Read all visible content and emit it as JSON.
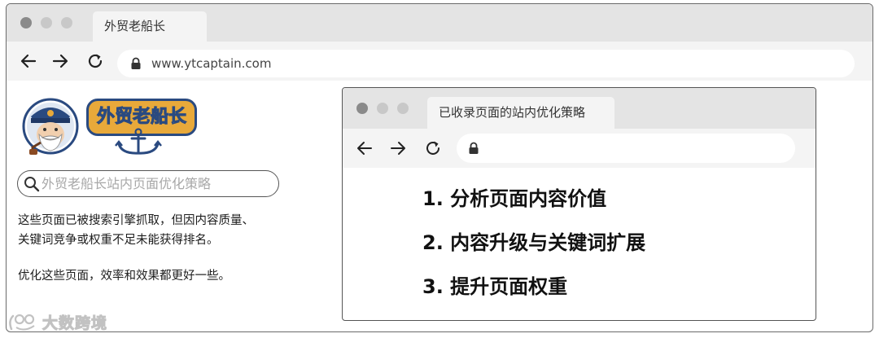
{
  "browser": {
    "tab_title": "外贸老船长",
    "url": "www.ytcaptain.com"
  },
  "logo": {
    "text": "外贸老船长"
  },
  "search": {
    "placeholder": "外贸老船长站内页面优化策略"
  },
  "description": {
    "line1": "这些页面已被搜索引擎抓取，但因内容质量、",
    "line2": "关键词竞争或权重不足未能获得排名。",
    "line3": "优化这些页面，效率和效果都更好一些。"
  },
  "inner_browser": {
    "tab_title": "已收录页面的站内优化策略",
    "items": [
      "1. 分析页面内容价值",
      "2. 内容升级与关键词扩展",
      "3. 提升页面权重"
    ]
  },
  "watermark": {
    "text": "大数跨境"
  },
  "colors": {
    "window_dot": "#8a8a8a",
    "tabbar_bg": "#e4e4e4",
    "navbar_bg": "#f4f4f4",
    "logo_blue": "#2a4a80",
    "logo_gold": "#e8a93a"
  }
}
